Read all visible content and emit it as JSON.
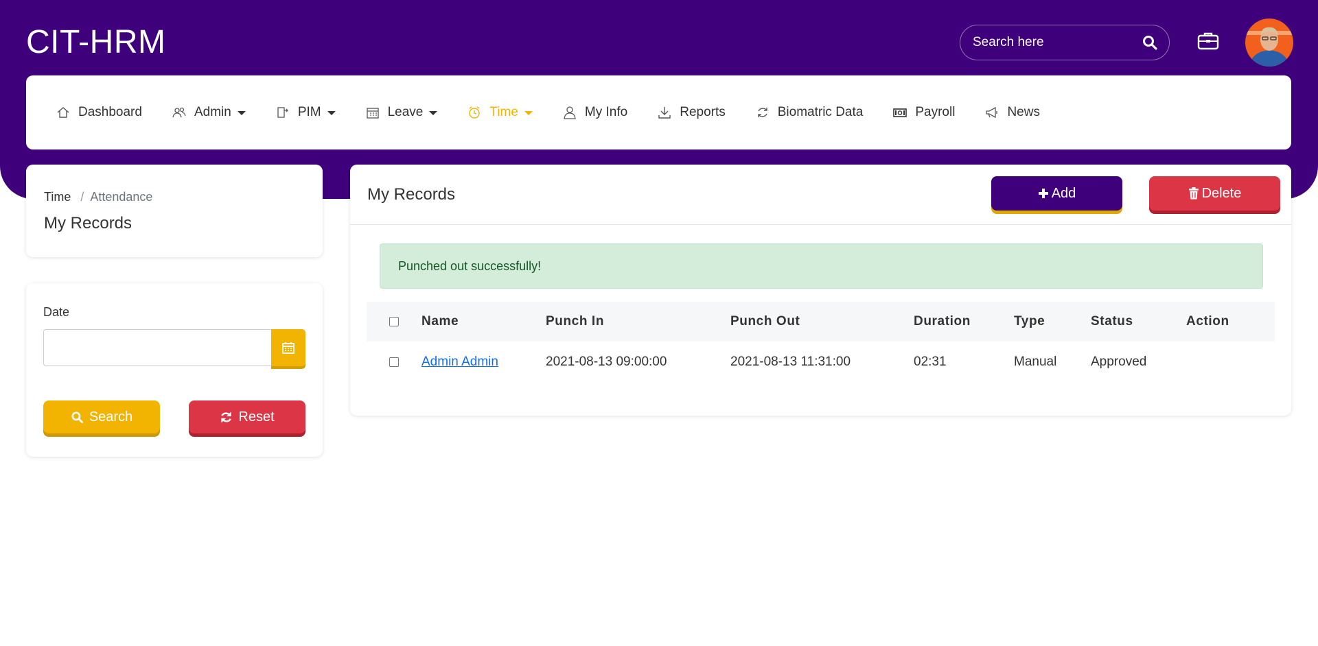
{
  "app": {
    "brand": "CIT-HRM"
  },
  "header": {
    "search_placeholder": "Search here",
    "icons": [
      "search-icon",
      "briefcase-icon"
    ]
  },
  "nav": {
    "items": [
      {
        "label": "Dashboard",
        "icon": "home-icon"
      },
      {
        "label": "Admin",
        "icon": "users-icon",
        "dropdown": true
      },
      {
        "label": "PIM",
        "icon": "id-icon",
        "dropdown": true
      },
      {
        "label": "Leave",
        "icon": "calendar-icon",
        "dropdown": true
      },
      {
        "label": "Time",
        "icon": "clock-icon",
        "dropdown": true,
        "active": true
      },
      {
        "label": "My Info",
        "icon": "user-icon"
      },
      {
        "label": "Reports",
        "icon": "download-icon"
      },
      {
        "label": "Biomatric Data",
        "icon": "refresh-icon"
      },
      {
        "label": "Payroll",
        "icon": "money-icon"
      },
      {
        "label": "News",
        "icon": "megaphone-icon"
      }
    ]
  },
  "breadcrumb": {
    "root": "Time",
    "current": "Attendance",
    "title": "My Records"
  },
  "filter": {
    "date_label": "Date",
    "date_value": "",
    "search_label": "Search",
    "reset_label": "Reset"
  },
  "records": {
    "title": "My Records",
    "add_label": "Add",
    "delete_label": "Delete",
    "alert": "Punched out successfully!",
    "columns": [
      "Name",
      "Punch In",
      "Punch Out",
      "Duration",
      "Type",
      "Status",
      "Action"
    ],
    "rows": [
      {
        "name": "Admin Admin",
        "punch_in": "2021-08-13 09:00:00",
        "punch_out": "2021-08-13 11:31:00",
        "duration": "02:31",
        "type": "Manual",
        "status": "Approved",
        "action": ""
      }
    ]
  },
  "colors": {
    "primary": "#3f007c",
    "accent": "#f2b400",
    "danger": "#dc3545",
    "success_bg": "#d4edda"
  }
}
